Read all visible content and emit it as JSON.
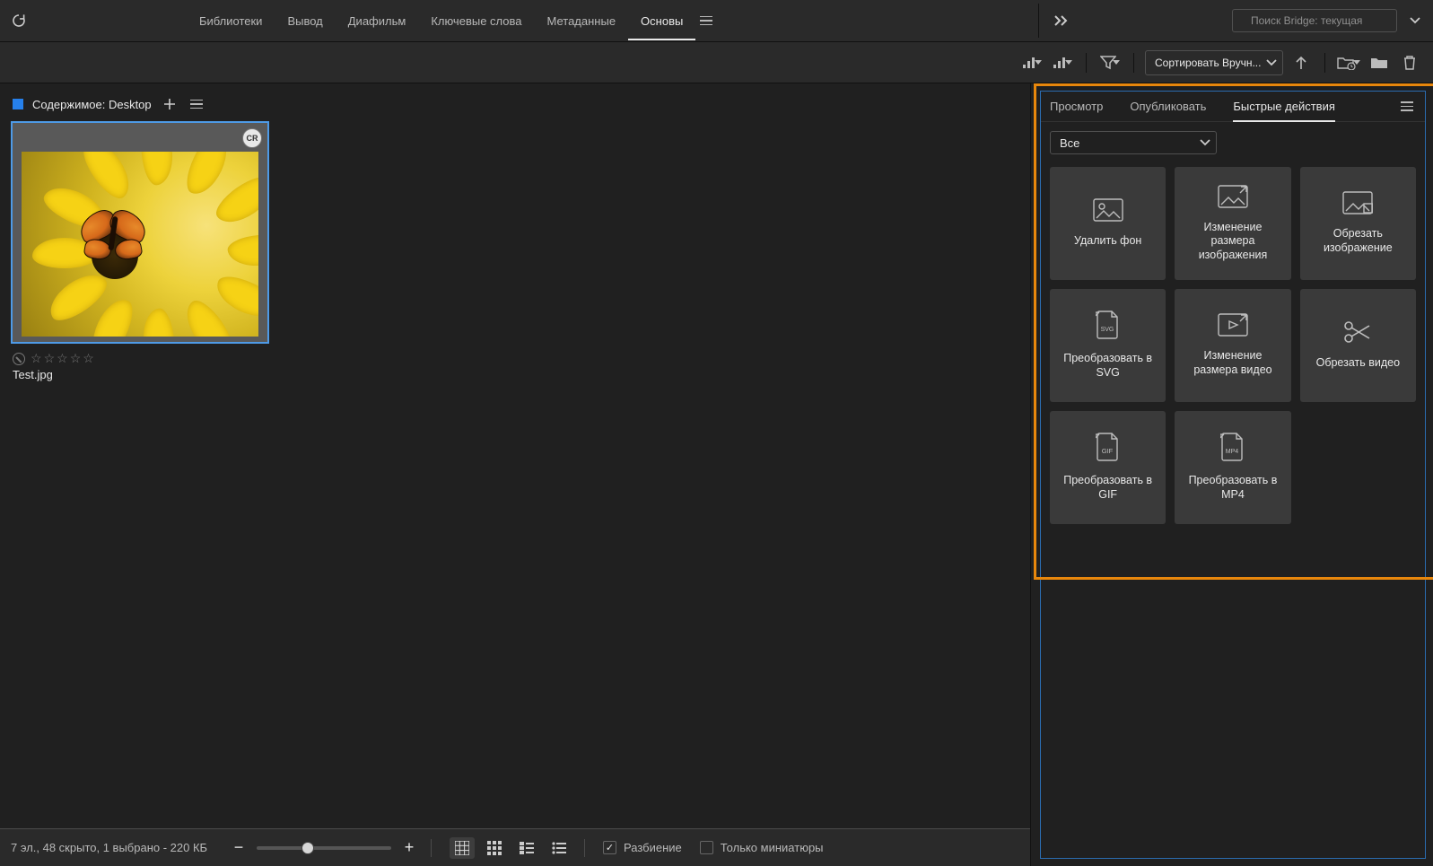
{
  "topnav": {
    "items": [
      "Библиотеки",
      "Вывод",
      "Диафильм",
      "Ключевые слова",
      "Метаданные",
      "Основы"
    ],
    "active_index": 5
  },
  "search": {
    "placeholder": "Поиск Bridge: текущая"
  },
  "toolbar": {
    "sort_label": "Сортировать Вручн..."
  },
  "panel": {
    "title": "Содержимое: Desktop"
  },
  "thumb": {
    "cr_badge": "CR",
    "filename": "Test.jpg"
  },
  "statusbar": {
    "text": "7 эл., 48 скрыто, 1 выбрано - 220 КБ",
    "split_label": "Разбиение",
    "thumbs_only_label": "Только миниатюры"
  },
  "rightpanel": {
    "tabs": [
      "Просмотр",
      "Опубликовать",
      "Быстрые действия"
    ],
    "active_tab_index": 2,
    "filter_label": "Все",
    "tiles": [
      "Удалить фон",
      "Изменение размера изображения",
      "Обрезать изображение",
      "Преобразовать в SVG",
      "Изменение размера видео",
      "Обрезать видео",
      "Преобразовать в GIF",
      "Преобразовать в MP4"
    ]
  }
}
